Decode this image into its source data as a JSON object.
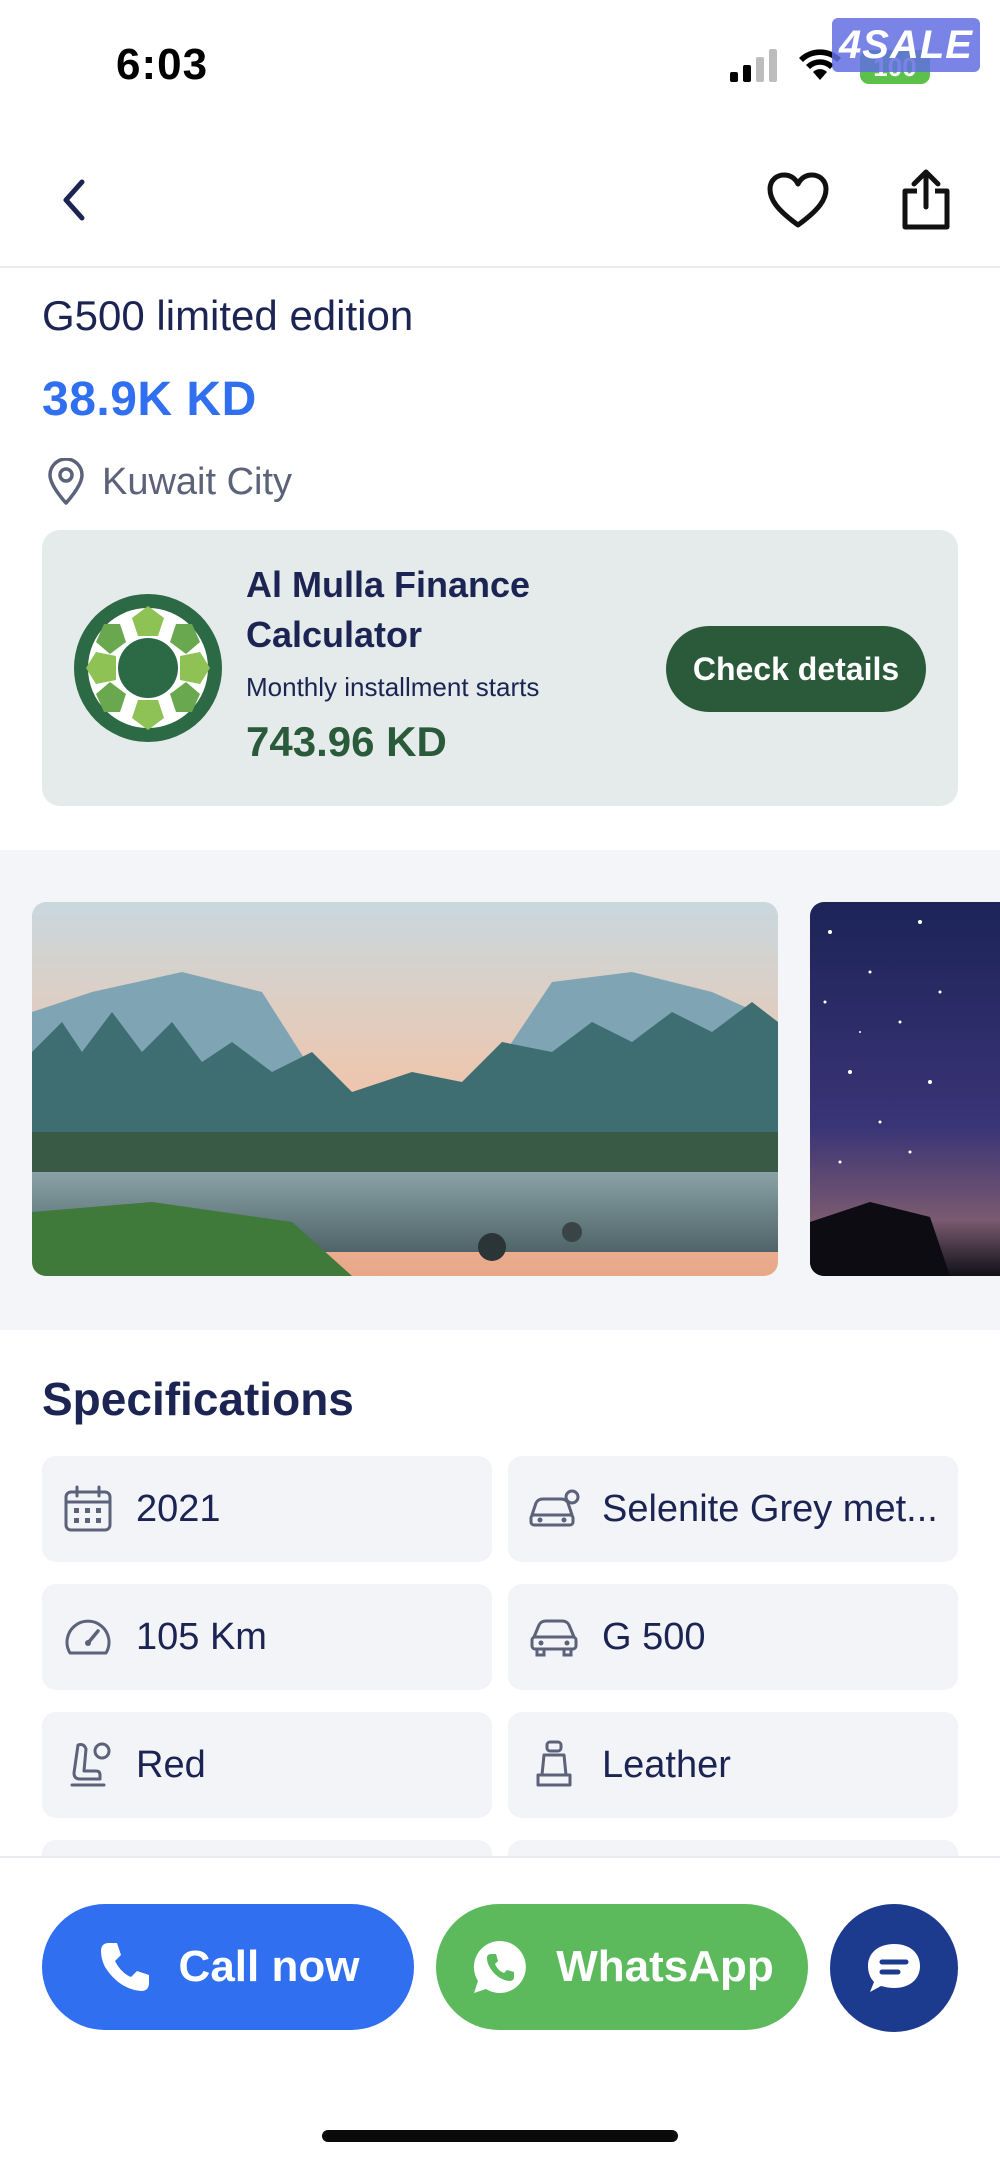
{
  "status_bar": {
    "time": "6:03",
    "battery": "100",
    "brand_logo": "4SALE"
  },
  "nav": {
    "back_icon": "chevron-left-icon",
    "favorite_icon": "heart-icon",
    "share_icon": "share-icon"
  },
  "listing": {
    "title": "G500 limited edition",
    "price": "38.9K KD",
    "location": "Kuwait City"
  },
  "finance": {
    "title": "Al Mulla Finance Calculator",
    "subtitle": "Monthly installment starts",
    "amount": "743.96 KD",
    "button_label": "Check details",
    "accent_color": "#2b5a3a"
  },
  "gallery": {
    "photos": [
      "mountain-valley-river-photo",
      "starry-night-sky-photo"
    ]
  },
  "specifications": {
    "heading": "Specifications",
    "items": [
      {
        "icon": "calendar-icon",
        "value": "2021"
      },
      {
        "icon": "car-paint-icon",
        "value": "Selenite Grey met..."
      },
      {
        "icon": "speedometer-icon",
        "value": "105 Km"
      },
      {
        "icon": "car-icon",
        "value": "G 500"
      },
      {
        "icon": "seat-color-icon",
        "value": "Red"
      },
      {
        "icon": "seat-icon",
        "value": "Leather"
      }
    ]
  },
  "actions": {
    "call_label": "Call now",
    "whatsapp_label": "WhatsApp",
    "call_color": "#2f6ff0",
    "whatsapp_color": "#5cba5c",
    "chat_color": "#1c3a8e"
  }
}
